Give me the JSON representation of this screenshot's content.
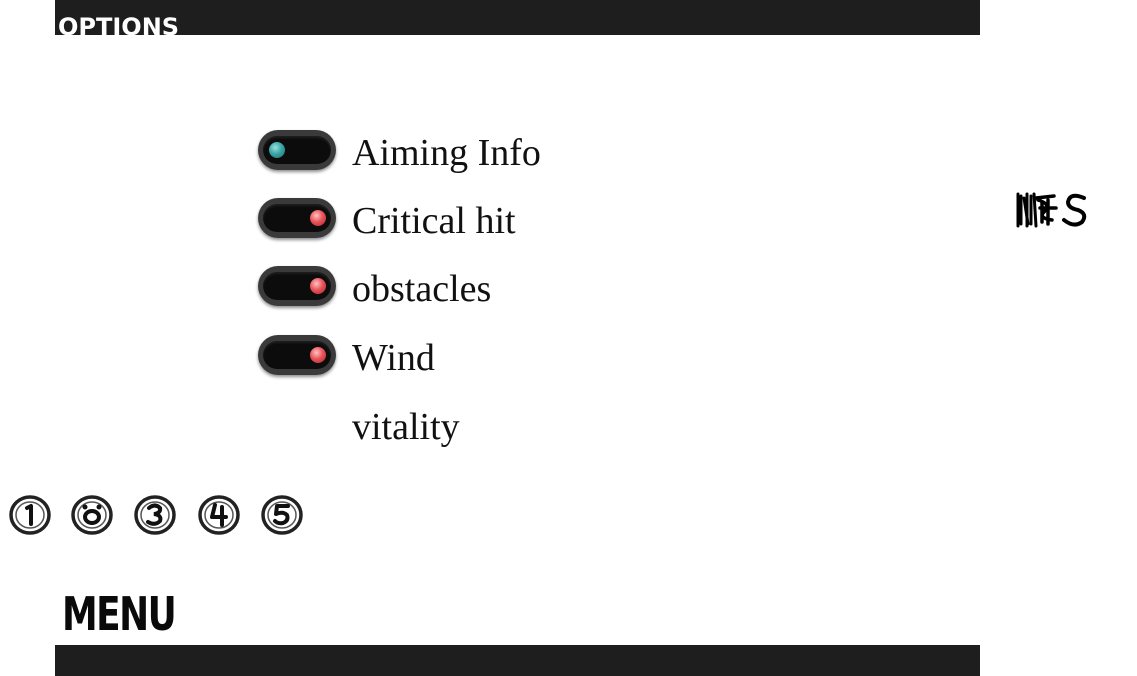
{
  "header": {
    "title": "OPTIONS"
  },
  "options": [
    {
      "label": "Aiming Info",
      "state": "on",
      "knob_color": "#3aa6a6"
    },
    {
      "label": "Critical hit",
      "state": "off",
      "knob_color": "#e8555a"
    },
    {
      "label": "obstacles",
      "state": "off",
      "knob_color": "#e8555a"
    },
    {
      "label": "Wind",
      "state": "off",
      "knob_color": "#e8555a"
    },
    {
      "label": "vitality"
    }
  ],
  "level_buttons": [
    "1",
    "2",
    "3",
    "4",
    "5"
  ],
  "logo": {
    "icon": "scribble-logo-icon",
    "text": "UKIS"
  },
  "footer": {
    "menu_label": "MENU"
  },
  "colors": {
    "bar": "#1f1e1e",
    "background": "#ffffff",
    "toggle_on": "#3aa6a6",
    "toggle_off": "#e8555a"
  }
}
